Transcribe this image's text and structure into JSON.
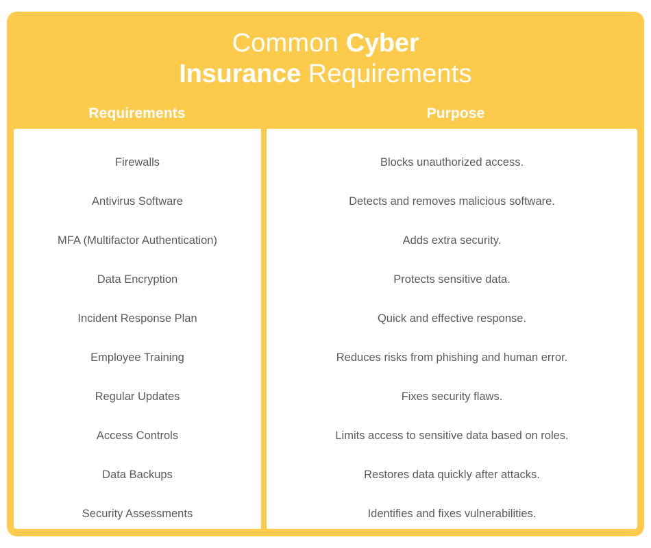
{
  "card": {
    "background_color": "#fdcb4c",
    "body_background_color": "#ffffff",
    "text_color": "#5a5a5c",
    "header_text_color": "#ffffff"
  },
  "title": {
    "line1_plain": "Common ",
    "line1_strong": "Cyber",
    "line2_strong": "Insurance",
    "line2_plain": " Requirements",
    "full_text": "Common Cyber Insurance Requirements"
  },
  "columns": {
    "left_header": "Requirements",
    "right_header": "Purpose"
  },
  "rows": [
    {
      "requirement": "Firewalls",
      "purpose": "Blocks unauthorized access."
    },
    {
      "requirement": "Antivirus Software",
      "purpose": "Detects and removes malicious software."
    },
    {
      "requirement": "MFA (Multifactor Authentication)",
      "purpose": "Adds extra security."
    },
    {
      "requirement": "Data Encryption",
      "purpose": "Protects sensitive data."
    },
    {
      "requirement": "Incident Response Plan",
      "purpose": "Quick and effective response."
    },
    {
      "requirement": "Employee Training",
      "purpose": "Reduces risks from phishing and human error."
    },
    {
      "requirement": "Regular Updates",
      "purpose": "Fixes security flaws."
    },
    {
      "requirement": "Access Controls",
      "purpose": "Limits access to sensitive data based on roles."
    },
    {
      "requirement": "Data Backups",
      "purpose": "Restores data quickly after attacks."
    },
    {
      "requirement": "Security Assessments",
      "purpose": "Identifies and fixes vulnerabilities."
    }
  ]
}
